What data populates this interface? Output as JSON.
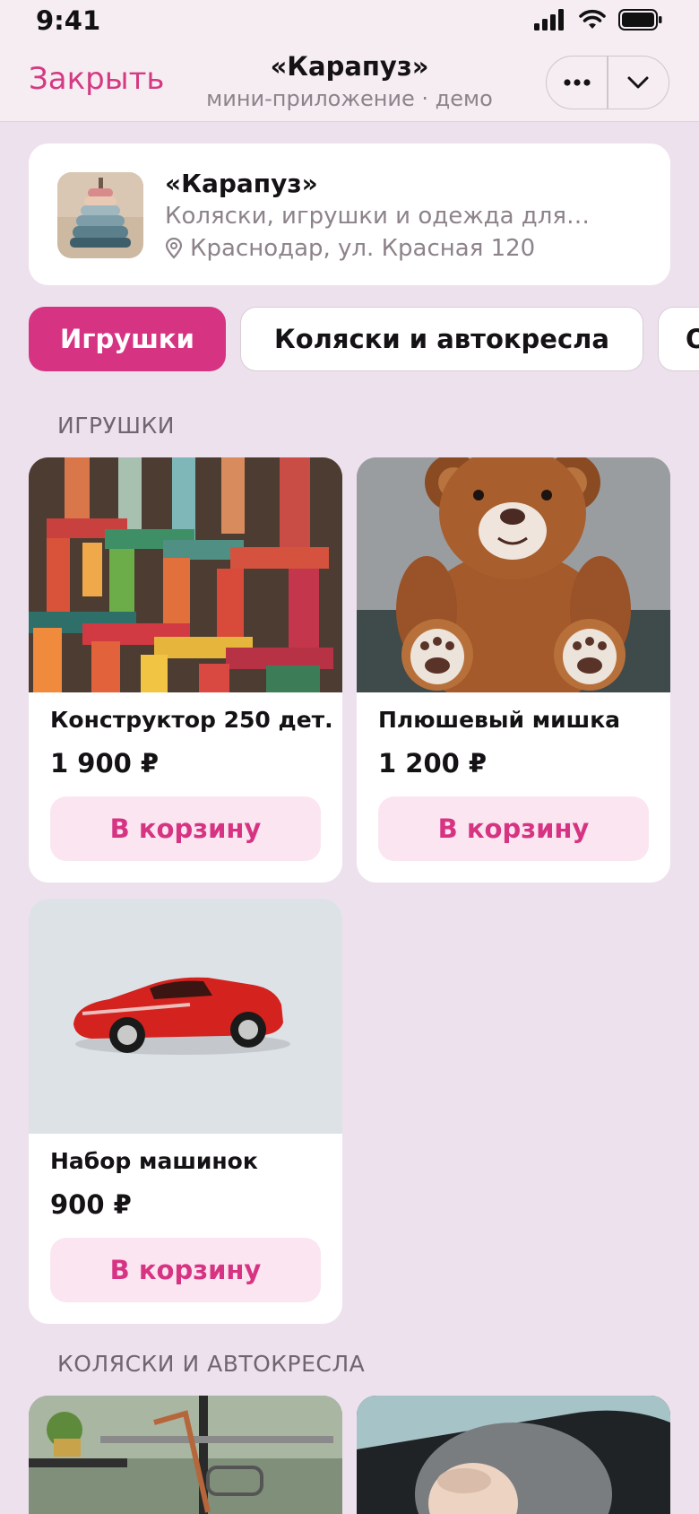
{
  "status": {
    "time": "9:41"
  },
  "header": {
    "close_label": "Закрыть",
    "title": "«Карапуз»",
    "subtitle": "мини-приложение · демо"
  },
  "shop": {
    "name": "«Карапуз»",
    "description": "Коляски, игрушки и одежда для…",
    "address": "Краснодар, ул. Красная 120"
  },
  "tabs": [
    {
      "label": "Игрушки",
      "active": true
    },
    {
      "label": "Коляски и автокресла",
      "active": false
    },
    {
      "label": "О",
      "active": false
    }
  ],
  "sections": [
    {
      "title": "ИГРУШКИ",
      "products": [
        {
          "name": "Конструктор 250 дет.",
          "price": "1 900 ₽",
          "button": "В корзину",
          "image": "colorful-wooden-blocks"
        },
        {
          "name": "Плюшевый мишка",
          "price": "1 200 ₽",
          "button": "В корзину",
          "image": "teddy-bear"
        },
        {
          "name": "Набор машинок",
          "price": "900 ₽",
          "button": "В корзину",
          "image": "red-toy-car"
        }
      ]
    },
    {
      "title": "КОЛЯСКИ И АВТОКРЕСЛА",
      "products": [
        {
          "image": "stroller-outdoor"
        },
        {
          "image": "baby-in-car-seat"
        }
      ]
    }
  ],
  "colors": {
    "accent": "#d63483",
    "accent_soft": "#fbe5f0",
    "background": "#ede1ee",
    "header_bg": "#f6edf3",
    "muted_text": "#8d838a"
  }
}
